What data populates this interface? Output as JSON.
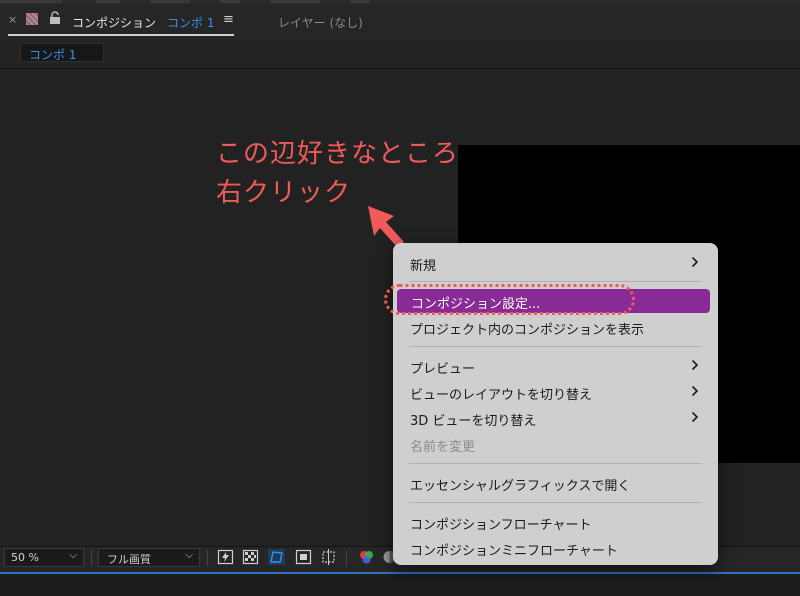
{
  "tab": {
    "close_glyph": "×",
    "title": "コンポジション",
    "comp_name": "コンポ 1",
    "menu_glyph": "≡",
    "layer_tab": "レイヤー (なし)"
  },
  "subbar": {
    "comp_chip": "コンポ 1"
  },
  "annotation": {
    "line1": "この辺好きなところ",
    "line2": "右クリック",
    "color": "#f05a5a"
  },
  "context_menu": {
    "items": [
      {
        "label": "新規",
        "submenu": true
      },
      {
        "label": "コンポジション設定...",
        "highlighted": true
      },
      {
        "label": "プロジェクト内のコンポジションを表示"
      },
      {
        "label": "プレビュー",
        "submenu": true
      },
      {
        "label": "ビューのレイアウトを切り替え",
        "submenu": true
      },
      {
        "label": "3D ビューを切り替え",
        "submenu": true
      },
      {
        "label": "名前を変更",
        "disabled": true
      },
      {
        "label": "エッセンシャルグラフィックスで開く"
      },
      {
        "label": "コンポジションフローチャート"
      },
      {
        "label": "コンポジションミニフローチャート"
      }
    ],
    "highlight_color": "#8a2a96"
  },
  "toolbar": {
    "zoom": "50 %",
    "resolution": "フル画質",
    "icons": [
      "fast-previews-icon",
      "transparency-grid-icon",
      "mask-path-icon",
      "region-of-interest-icon",
      "target-region-icon",
      "color-channels-icon",
      "exposure-icon"
    ]
  },
  "colors": {
    "accent_blue": "#3d8fe6",
    "background": "#232323"
  }
}
